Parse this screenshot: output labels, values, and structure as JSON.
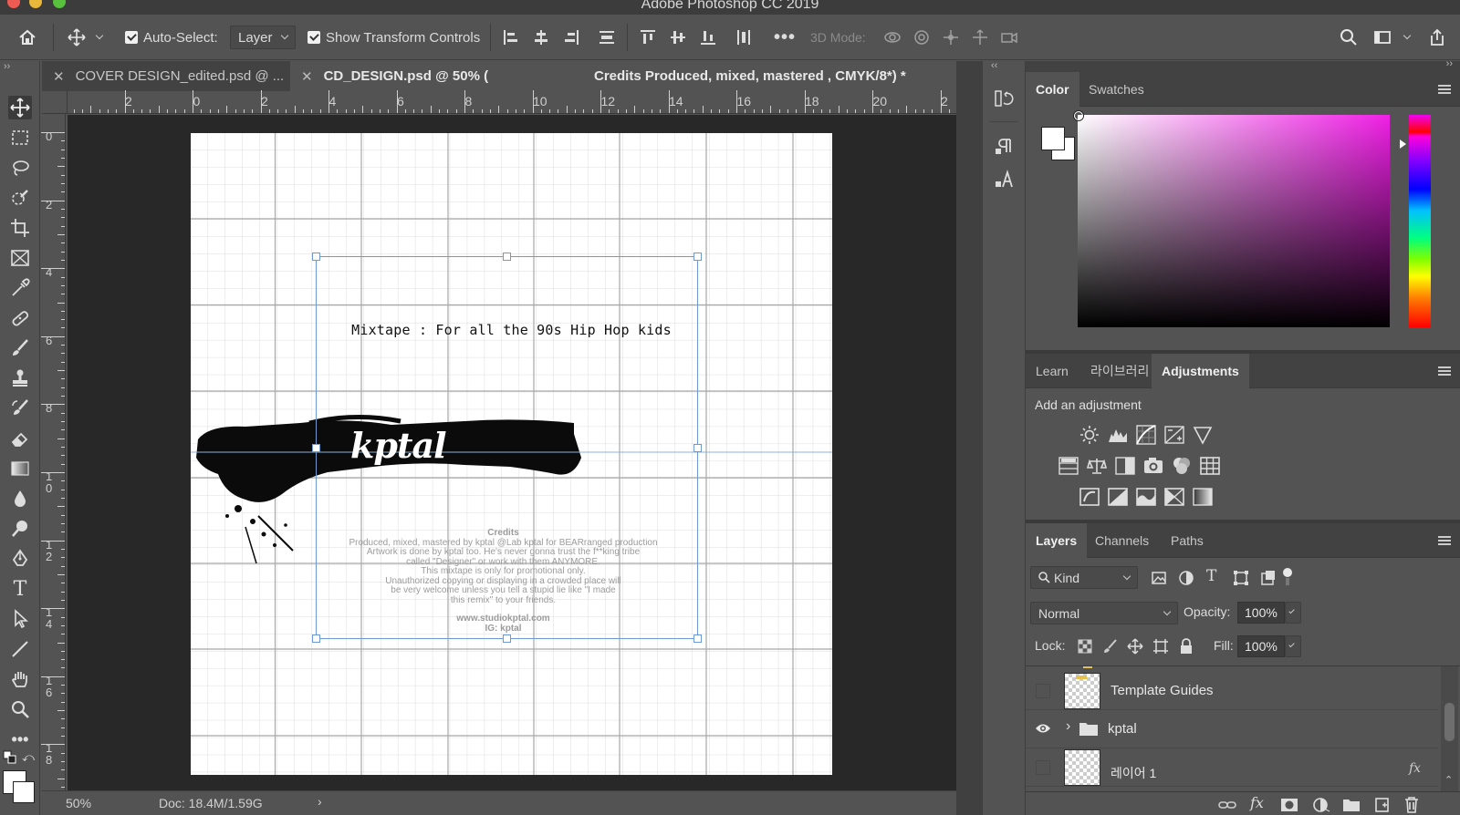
{
  "window": {
    "title": "Adobe Photoshop CC 2019"
  },
  "options_bar": {
    "auto_select_label": "Auto-Select:",
    "auto_select_value": "Layer",
    "show_transform_label": "Show Transform Controls",
    "mode_3d_label": "3D Mode:"
  },
  "tabs": [
    {
      "label": "COVER DESIGN_edited.psd @ ..."
    },
    {
      "label": "CD_DESIGN.psd @ 50% (",
      "label_tail": "Credits Produced, mixed, mastered , CMYK/8*) *"
    }
  ],
  "ruler_h": [
    "2",
    "0",
    "2",
    "4",
    "6",
    "8",
    "10",
    "12",
    "14",
    "16",
    "18",
    "20",
    "2"
  ],
  "ruler_v": [
    "0",
    "2",
    "4",
    "6",
    "8",
    "1\n0",
    "1\n2",
    "1\n4",
    "1\n6",
    "1\n8"
  ],
  "canvas": {
    "headline": "Mixtape : For all the 90s Hip Hop kids",
    "logo_text": "kptal",
    "credits_title": "Credits",
    "credits_lines": [
      "Produced, mixed, mastered by kptal @Lab kptal for BEARranged production",
      "Artwork is done by kptal too. He's never gonna trust the f**king tribe",
      "called \"Designer\" or work with them ANYMORE.",
      "This mixtape is only for promotional only.",
      "Unauthorized copying or displaying in a crowded place will",
      "be very welcome unless you tell a stupid lie like \"I made",
      "this remix\" to your friends."
    ],
    "website": "www.studiokptal.com",
    "ig": "IG: kptal"
  },
  "status": {
    "zoom": "50%",
    "doc": "Doc: 18.4M/1.59G"
  },
  "color_panel": {
    "tabs": [
      "Color",
      "Swatches"
    ],
    "active_tab": "Color",
    "hue_color": "#f020e6"
  },
  "adjustments_panel": {
    "tabs": [
      "Learn",
      "라이브러리",
      "Adjustments"
    ],
    "active_tab": "Adjustments",
    "heading": "Add an adjustment"
  },
  "layers_panel": {
    "tabs": [
      "Layers",
      "Channels",
      "Paths"
    ],
    "active_tab": "Layers",
    "filter_kind": "Kind",
    "blend_mode": "Normal",
    "opacity_label": "Opacity:",
    "opacity_value": "100%",
    "lock_label": "Lock:",
    "fill_label": "Fill:",
    "fill_value": "100%",
    "layers": [
      {
        "name": "Template Guides",
        "visible": false,
        "type": "layer"
      },
      {
        "name": "kptal",
        "visible": true,
        "type": "group"
      },
      {
        "name": "레이어 1",
        "visible": false,
        "type": "layer"
      }
    ]
  }
}
